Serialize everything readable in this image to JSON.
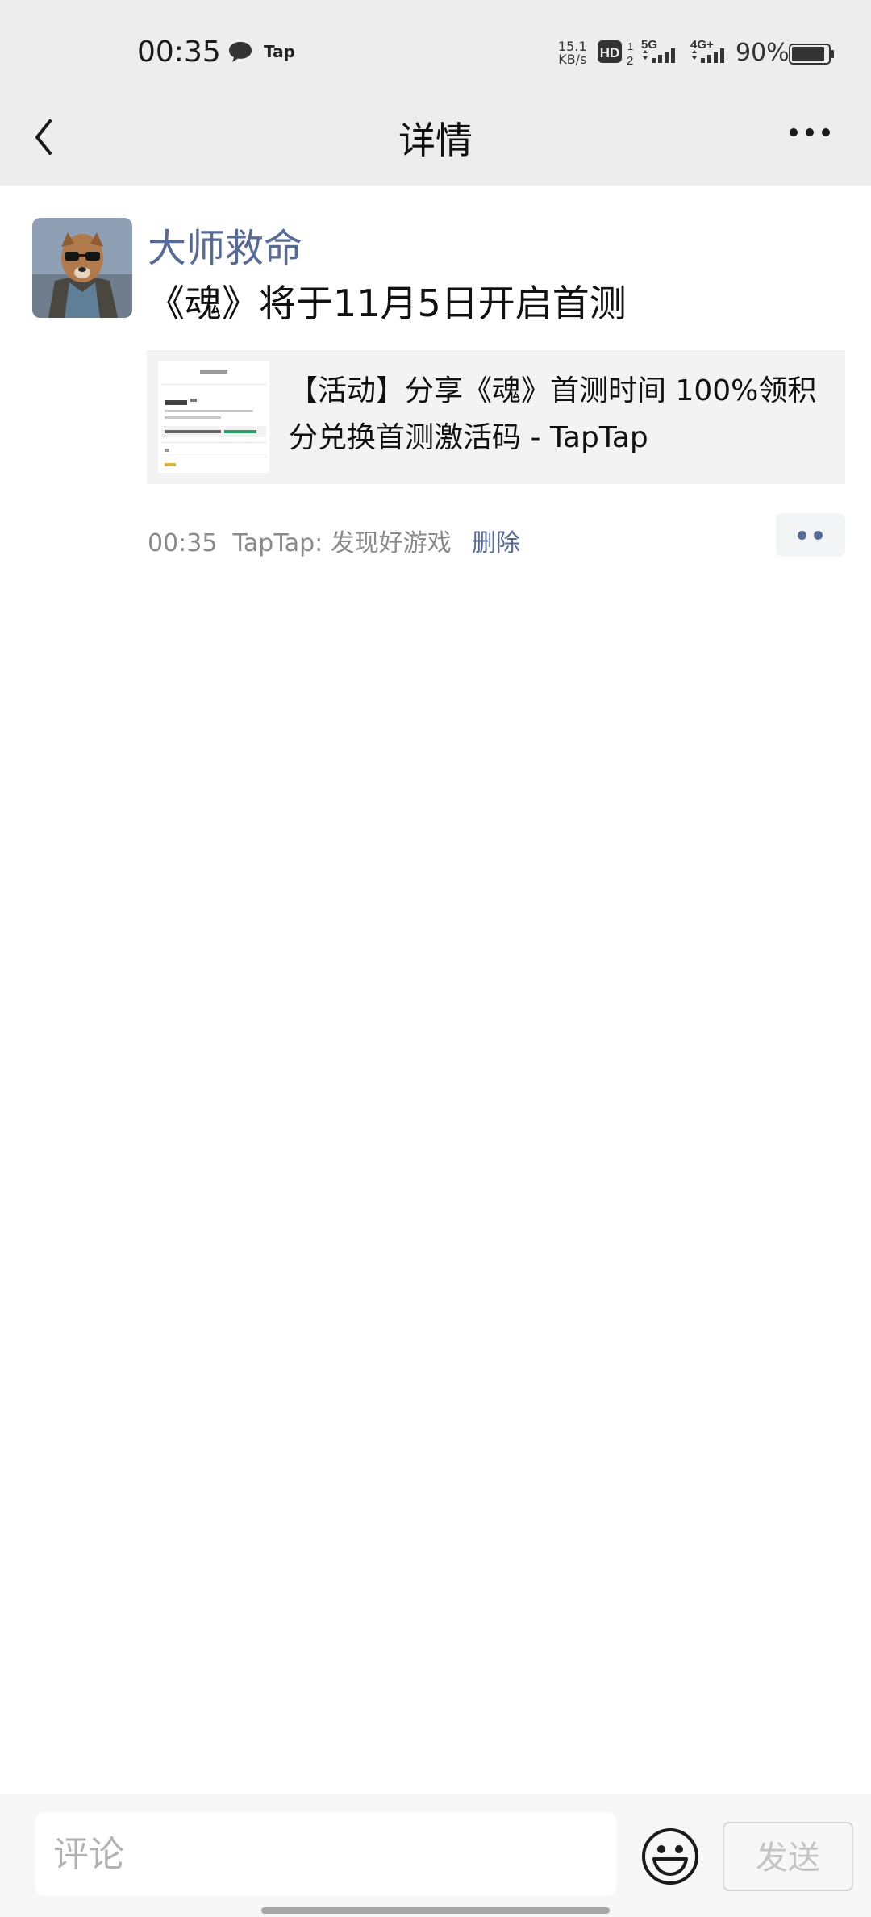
{
  "status_bar": {
    "time": "00:35",
    "notification_label": "Tap",
    "net_speed_value": "15.1",
    "net_speed_unit": "KB/s",
    "battery": "90%"
  },
  "nav": {
    "title": "详情"
  },
  "post": {
    "author": "大师救命",
    "text": "《魂》将于11月5日开启首测",
    "link": {
      "title": "【活动】分享《魂》首测时间 100%领积分兑换首测激活码 - TapTap"
    },
    "time": "00:35",
    "source": "TapTap: 发现好游戏",
    "delete_label": "删除"
  },
  "comment_bar": {
    "placeholder": "评论",
    "send_label": "发送"
  },
  "colors": {
    "link_blue": "#576b95",
    "header_bg": "#ededed"
  }
}
